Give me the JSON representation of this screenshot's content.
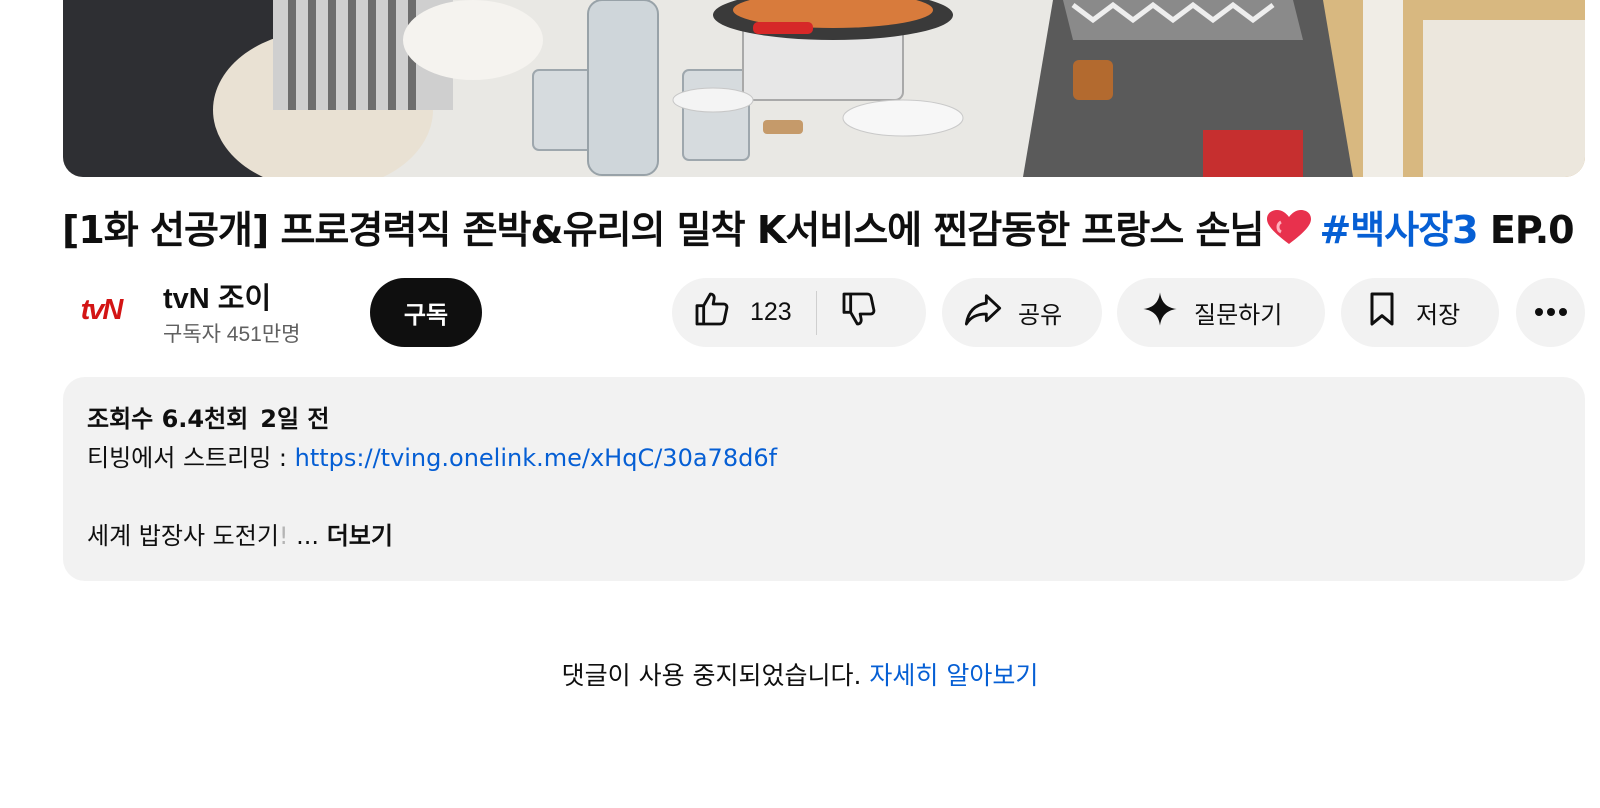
{
  "video": {
    "title_main": "[1화 선공개] 프로경력직 존박&유리의 밀착 K서비스에 찐감동한 프랑스 손님",
    "title_hashtag": "#백사장3",
    "title_suffix": "EP.0"
  },
  "channel": {
    "logo_text": "tvN",
    "name": "tvN 조이",
    "subscribers": "구독자 451만명",
    "subscribe_label": "구독"
  },
  "actions": {
    "like_count": "123",
    "share_label": "공유",
    "ask_label": "질문하기",
    "save_label": "저장"
  },
  "description": {
    "views": "조회수 6.4천회",
    "date": "2일 전",
    "stream_text": "티빙에서 스트리밍 : ",
    "stream_link": "https://tving.onelink.me/xHqC/30a78d6f",
    "line3_text": "세계 밥장사 도전기",
    "line3_fade": "!",
    "ellipsis": " ...",
    "more_label": "더보기"
  },
  "comments": {
    "disabled_text": "댓글이 사용 중지되었습니다.",
    "learn_more": "자세히 알아보기"
  },
  "colors": {
    "accent": "#065fd4",
    "brand": "#d31414",
    "pill_bg": "#f2f2f2"
  },
  "icons": [
    "thumbs-up-icon",
    "thumbs-down-icon",
    "share-icon",
    "sparkle-icon",
    "bookmark-icon",
    "more-icon",
    "heart-emoji-icon"
  ]
}
